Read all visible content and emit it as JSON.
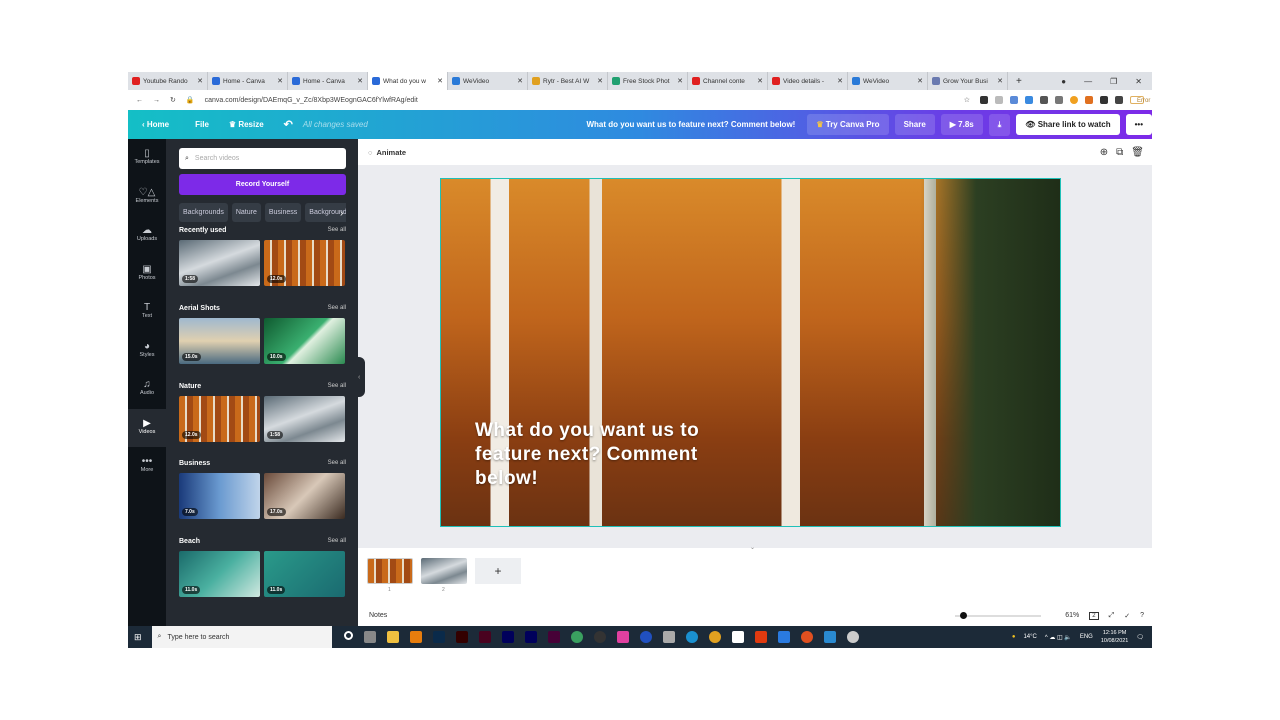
{
  "browser": {
    "tabs": [
      {
        "title": "Youtube Rando",
        "color": "#e02020"
      },
      {
        "title": "Home - Canva",
        "color": "#2a6ad8"
      },
      {
        "title": "Home - Canva",
        "color": "#2a6ad8"
      },
      {
        "title": "What do you w",
        "color": "#2a6ad8",
        "active": true
      },
      {
        "title": "WeVideo",
        "color": "#2a7ad8"
      },
      {
        "title": "Rytr - Best AI W",
        "color": "#e0a020"
      },
      {
        "title": "Free Stock Phot",
        "color": "#20a070"
      },
      {
        "title": "Channel conte",
        "color": "#e02020"
      },
      {
        "title": "Video details -",
        "color": "#e02020"
      },
      {
        "title": "WeVideo",
        "color": "#2a7ad8"
      },
      {
        "title": "Grow Your Busi",
        "color": "#6a7ab0"
      }
    ],
    "new_tab": "+",
    "url": "canva.com/design/DAEmqG_v_Zc/8Xbp3WEognGAC6fYlwfRAg/edit",
    "error_label": "Error"
  },
  "header": {
    "home": "Home",
    "file": "File",
    "resize": "Resize",
    "saved": "All changes saved",
    "title": "What do you want us to feature next? Comment below!",
    "try_pro": "Try Canva Pro",
    "share": "Share",
    "play": "7.8s",
    "share_link": "Share link to watch",
    "more": "•••"
  },
  "rail": [
    {
      "label": "Templates",
      "icon": "▯"
    },
    {
      "label": "Elements",
      "icon": "♡△"
    },
    {
      "label": "Uploads",
      "icon": "☁"
    },
    {
      "label": "Photos",
      "icon": "▣"
    },
    {
      "label": "Text",
      "icon": "T"
    },
    {
      "label": "Styles",
      "icon": "◕"
    },
    {
      "label": "Audio",
      "icon": "♫"
    },
    {
      "label": "Videos",
      "icon": "▶",
      "active": true
    },
    {
      "label": "More",
      "icon": "•••"
    }
  ],
  "panel": {
    "search_placeholder": "Search videos",
    "record": "Record Yourself",
    "chips": [
      "Backgrounds",
      "Nature",
      "Business",
      "Backgrounds"
    ],
    "see_all": "See all",
    "sections": [
      {
        "title": "Recently used",
        "items": [
          {
            "dur": "1:58",
            "kind": "fog"
          },
          {
            "dur": "12.0s",
            "kind": "aut"
          }
        ]
      },
      {
        "title": "Aerial Shots",
        "items": [
          {
            "dur": "15.0s",
            "kind": "bridge"
          },
          {
            "dur": "10.0s",
            "kind": "green"
          }
        ]
      },
      {
        "title": "Nature",
        "items": [
          {
            "dur": "12.0s",
            "kind": "aut"
          },
          {
            "dur": "1:58",
            "kind": "fog"
          }
        ]
      },
      {
        "title": "Business",
        "items": [
          {
            "dur": "7.0s",
            "kind": "sky"
          },
          {
            "dur": "17.0s",
            "kind": "desk"
          }
        ]
      },
      {
        "title": "Beach",
        "items": [
          {
            "dur": "11.0s",
            "kind": "sea"
          },
          {
            "dur": "11.0s",
            "kind": "sea2"
          }
        ]
      }
    ]
  },
  "toolbar": {
    "animate": "Animate"
  },
  "design": {
    "text": "What do you want us to feature next? Comment below!"
  },
  "pages": {
    "numbers": [
      "1",
      "2"
    ],
    "add": "+"
  },
  "footer": {
    "notes": "Notes",
    "zoom": "61%",
    "zoom_fraction": 0.61,
    "page_count": "2"
  },
  "taskbar": {
    "search": "Type here to search",
    "temp": "14°C",
    "lang": "ENG",
    "time": "12:16 PM",
    "date": "10/08/2021"
  }
}
